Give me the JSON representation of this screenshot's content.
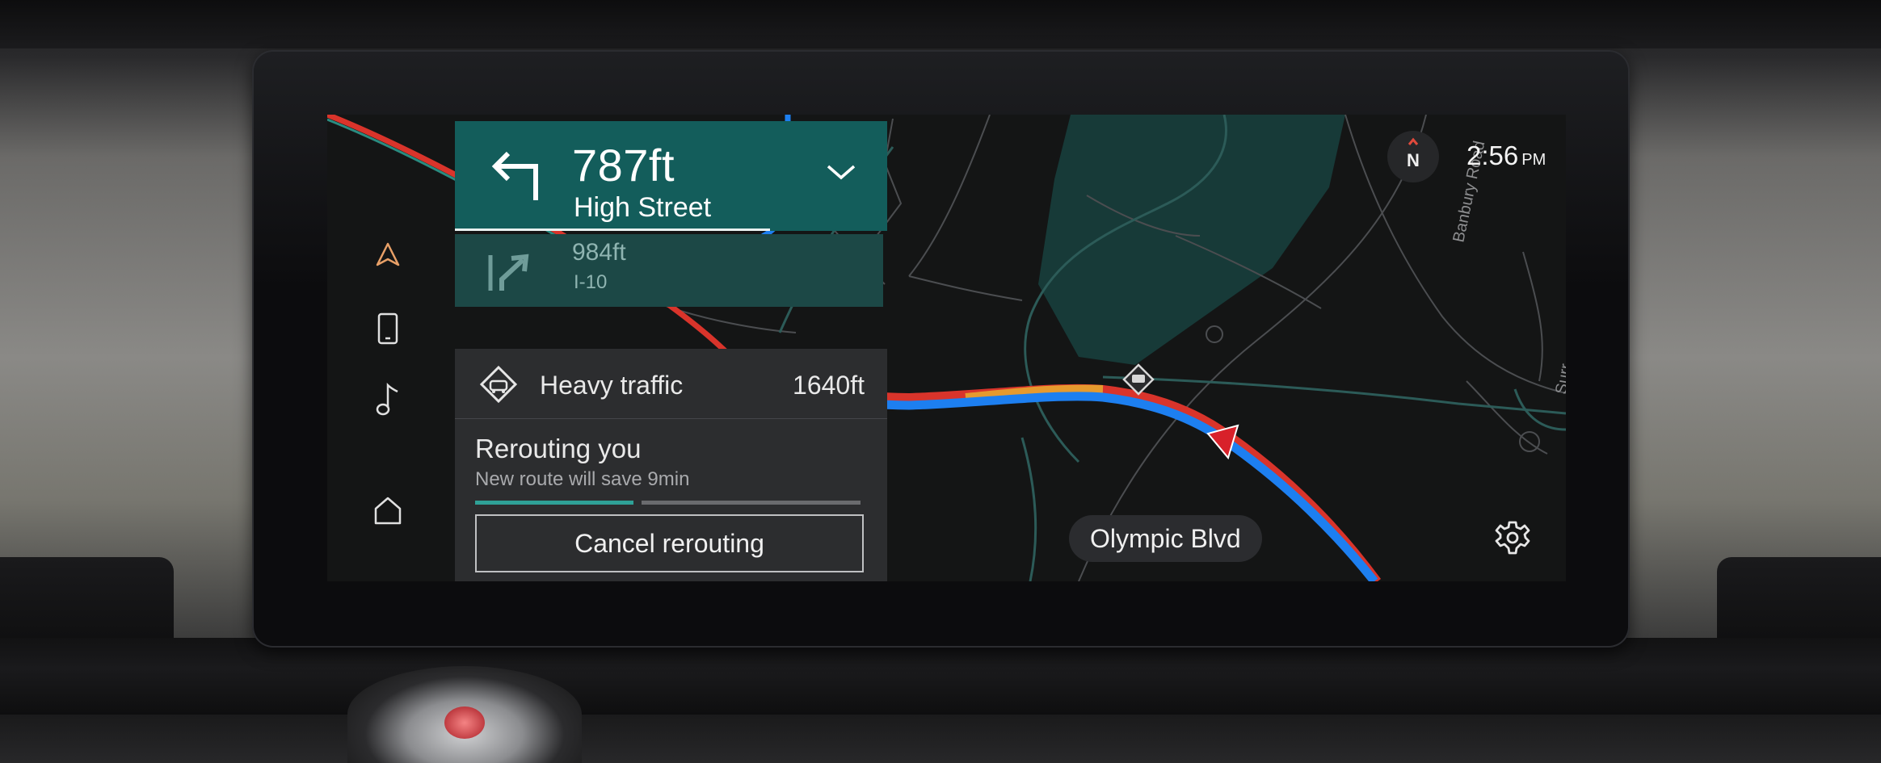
{
  "turn": {
    "distance": "787ft",
    "street": "High Street"
  },
  "next_turn": {
    "distance": "984ft",
    "road": "I-10"
  },
  "alert": {
    "title": "Heavy traffic",
    "distance": "1640ft",
    "reroute_title": "Rerouting you",
    "reroute_subtitle": "New route will save 9min",
    "progress_fraction": 0.41,
    "cancel_label": "Cancel rerouting"
  },
  "clock": {
    "time": "2:56",
    "meridiem": "PM"
  },
  "compass": {
    "heading": "N"
  },
  "map": {
    "current_street": "Olympic Blvd",
    "road_labels": [
      "Banbury Road",
      "Surr"
    ]
  },
  "colors": {
    "route": "#1d7ff0",
    "turn_card": "#135d5b",
    "traffic_red": "#d9342b",
    "traffic_orange": "#e69a2e",
    "nav_accent": "#e8a067",
    "position_arrow": "#d8212a"
  },
  "nav": [
    "navigation-icon",
    "phone-icon",
    "music-icon",
    "home-icon"
  ]
}
